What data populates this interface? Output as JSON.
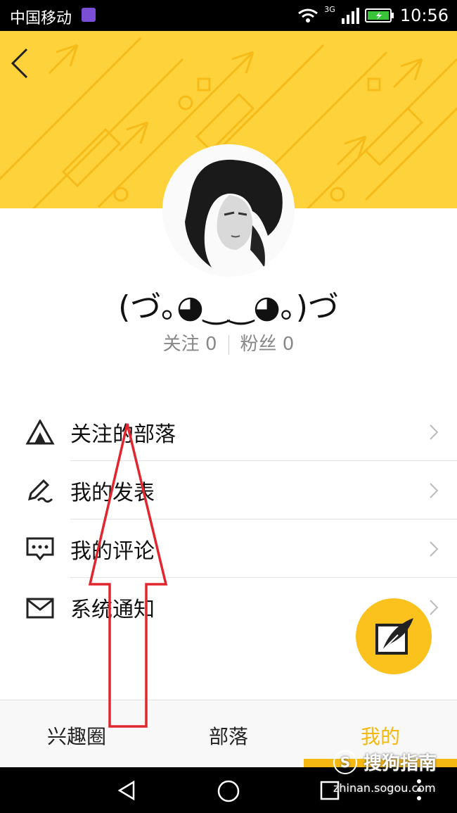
{
  "status_bar": {
    "carrier": "中国移动",
    "network": "3G",
    "time": "10:56"
  },
  "profile": {
    "username": "(づ｡◕‿‿◕｡)づ",
    "following_label": "关注",
    "following_count": "0",
    "followers_label": "粉丝",
    "followers_count": "0"
  },
  "menu": [
    {
      "label": "关注的部落",
      "icon": "tent-icon"
    },
    {
      "label": "我的发表",
      "icon": "pen-icon"
    },
    {
      "label": "我的评论",
      "icon": "comment-icon"
    },
    {
      "label": "系统通知",
      "icon": "mail-icon"
    }
  ],
  "tabs": [
    {
      "label": "兴趣圈"
    },
    {
      "label": "部落"
    },
    {
      "label": "我的",
      "active": true
    }
  ],
  "watermark": {
    "brand": "搜狗指南",
    "url": "zhinan.sogou.com"
  },
  "colors": {
    "accent": "#fbc21d",
    "header_bg": "#fdd23a",
    "annotation_arrow": "#e0262e"
  }
}
